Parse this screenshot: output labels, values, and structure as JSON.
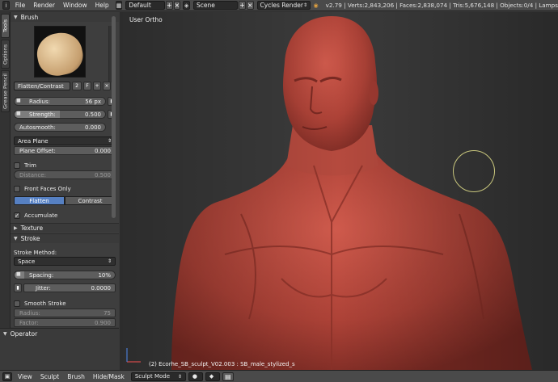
{
  "topbar": {
    "editor_icon": "info-editor-icon",
    "menus": [
      "File",
      "Render",
      "Window",
      "Help"
    ],
    "screen_layout": "Default",
    "scene": "Scene",
    "render_engine": "Cycles Render",
    "stats": "v2.79 | Verts:2,843,206 | Faces:2,838,074 | Tris:5,676,148 | Objects:0/4 | Lamps"
  },
  "tabs": [
    "Tools",
    "Options",
    "Grease Pencil"
  ],
  "brush_panel": {
    "header": "Brush",
    "brush_name": "Flatten/Contrast",
    "user_count": "2",
    "fake_user": "F",
    "radius": {
      "label": "Radius:",
      "value": "56 px"
    },
    "strength": {
      "label": "Strength:",
      "value": "0.500",
      "fraction": 0.5
    },
    "autosmooth": {
      "label": "Autosmooth:",
      "value": "0.000",
      "fraction": 0
    },
    "plane_mode": "Area Plane",
    "plane_offset": {
      "label": "Plane Offset:",
      "value": "0.000"
    },
    "trim": "Trim",
    "trim_distance": {
      "label": "Distance:",
      "value": "0.500"
    },
    "front_faces_only": "Front Faces Only",
    "direction": {
      "options": [
        "Flatten",
        "Contrast"
      ],
      "selected": "Flatten"
    },
    "accumulate": "Accumulate",
    "accumulate_checked": true
  },
  "texture_panel": {
    "header": "Texture"
  },
  "stroke_panel": {
    "header": "Stroke",
    "stroke_method_label": "Stroke Method:",
    "stroke_method": "Space",
    "spacing": {
      "label": "Spacing:",
      "value": "10%",
      "fraction": 0.1
    },
    "jitter": {
      "label": "Jitter:",
      "value": "0.0000"
    },
    "smooth_stroke": "Smooth Stroke",
    "radius": {
      "label": "Radius:",
      "value": "75"
    },
    "factor": {
      "label": "Factor:",
      "value": "0.900"
    }
  },
  "operator_panel": {
    "header": "Operator"
  },
  "viewport": {
    "view_label": "User Ortho",
    "object_label": "(2) Ecorhe_SB_sculpt_V02.003 : SB_male_stylized_s",
    "figure_color": "#b4463c",
    "brush_cursor_color": "#c9c77d"
  },
  "bottombar": {
    "menus": [
      "View",
      "Sculpt",
      "Brush",
      "Hide/Mask"
    ],
    "mode": "Sculpt Mode"
  }
}
